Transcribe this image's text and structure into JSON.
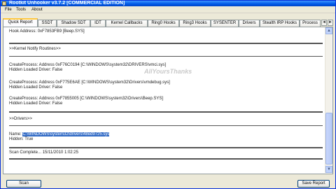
{
  "window": {
    "title": "Rootkit Unhooker v3.7.2 [COMMERCIAL EDITION]"
  },
  "menu": [
    "File",
    "Tools",
    "About"
  ],
  "tabs": [
    "Quick Report",
    "SSDT",
    "Shadow SDT",
    "IDT",
    "Kernel Callbacks",
    "Ring0 Hooks",
    "Ring3 Hooks",
    "SYSENTER",
    "Drivers",
    "Stealth IRP Hooks",
    "Process"
  ],
  "report": {
    "hook_address": "Hook Address: 0xF7853FB9 [Beep.SYS]",
    "notify_header": ">>Kernel Notify Routines>>",
    "cp1": "CreateProcess: Address 0xF76C0194 [C:\\WINDOWS\\system32\\DRIVERS\\vmci.sys]",
    "cp1_hidden": "Hidden Loaded Driver: False",
    "cp2": "CreateProcess: Address 0xF775E6AE [C:\\WINDOWS\\system32\\Drivers\\vmdebug.sys]",
    "cp2_hidden": "Hidden Loaded Driver: False",
    "cp3": "CreateProcess: Address 0xF7855005 [C:\\WINDOWS\\system32\\Drivers\\Beep.SYS]",
    "cp3_hidden": "Hidden Loaded Driver: False",
    "drivers_header": ">>Drivers>>",
    "name_prefix": "Name: ",
    "name_selected": "C:\\WINDOWS\\system32\\drivers\\48ed9725.sys",
    "hidden": "Hidden: True",
    "scan_complete": "Scan Complete... 15/11/2010 1:02:25"
  },
  "watermark": "AllYoursThanks",
  "buttons": {
    "scan": "Scan",
    "save_report": "Save Report"
  },
  "scrollbar": {
    "up_icon": "▲",
    "down_icon": "▼"
  },
  "tab_nav": {
    "left_icon": "◄",
    "right_icon": "►"
  }
}
